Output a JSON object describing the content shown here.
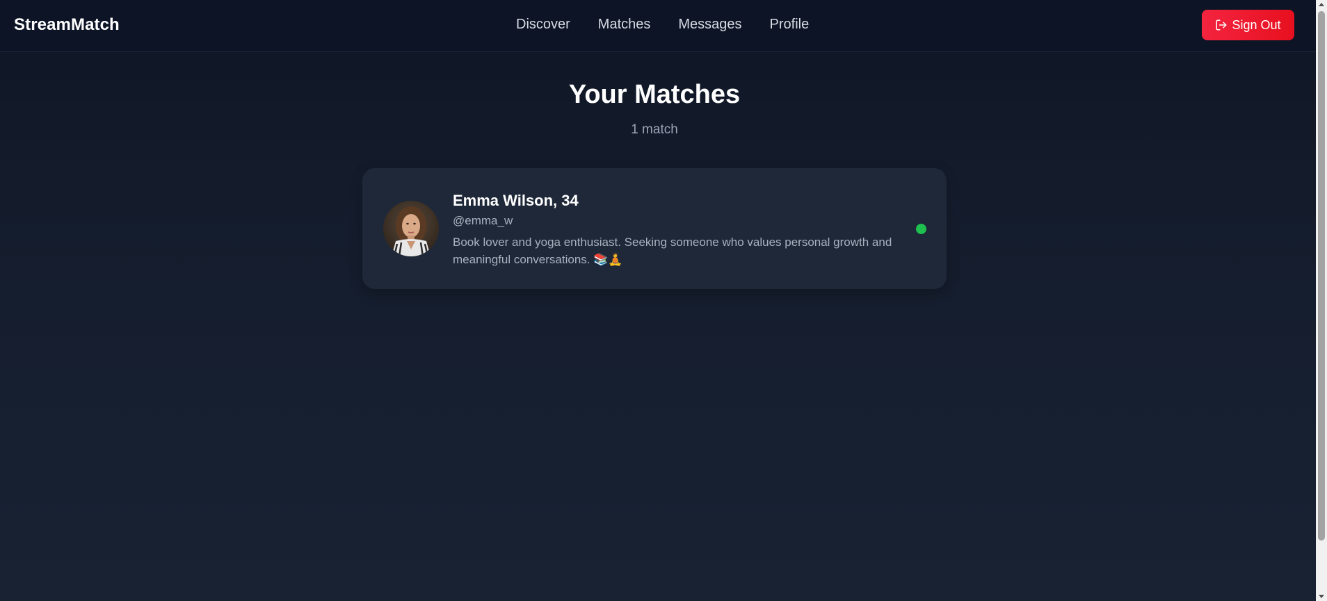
{
  "app": {
    "brand": "StreamMatch"
  },
  "nav": {
    "items": [
      {
        "label": "Discover"
      },
      {
        "label": "Matches"
      },
      {
        "label": "Messages"
      },
      {
        "label": "Profile"
      }
    ],
    "sign_out_label": "Sign Out"
  },
  "main": {
    "title": "Your Matches",
    "count_text": "1 match"
  },
  "matches": [
    {
      "name_age": "Emma Wilson, 34",
      "handle": "@emma_w",
      "bio": "Book lover and yoga enthusiast. Seeking someone who values personal growth and meaningful conversations. 📚🧘",
      "online": true
    }
  ],
  "colors": {
    "background": "#141c2c",
    "navbar": "#0c1426",
    "card": "#1e2838",
    "accent_red": "#f0192f",
    "online_green": "#1ec04f",
    "muted_text": "#a9b1bf"
  },
  "icons": {
    "sign_out": "sign-out-icon",
    "online": "online-status-icon"
  }
}
